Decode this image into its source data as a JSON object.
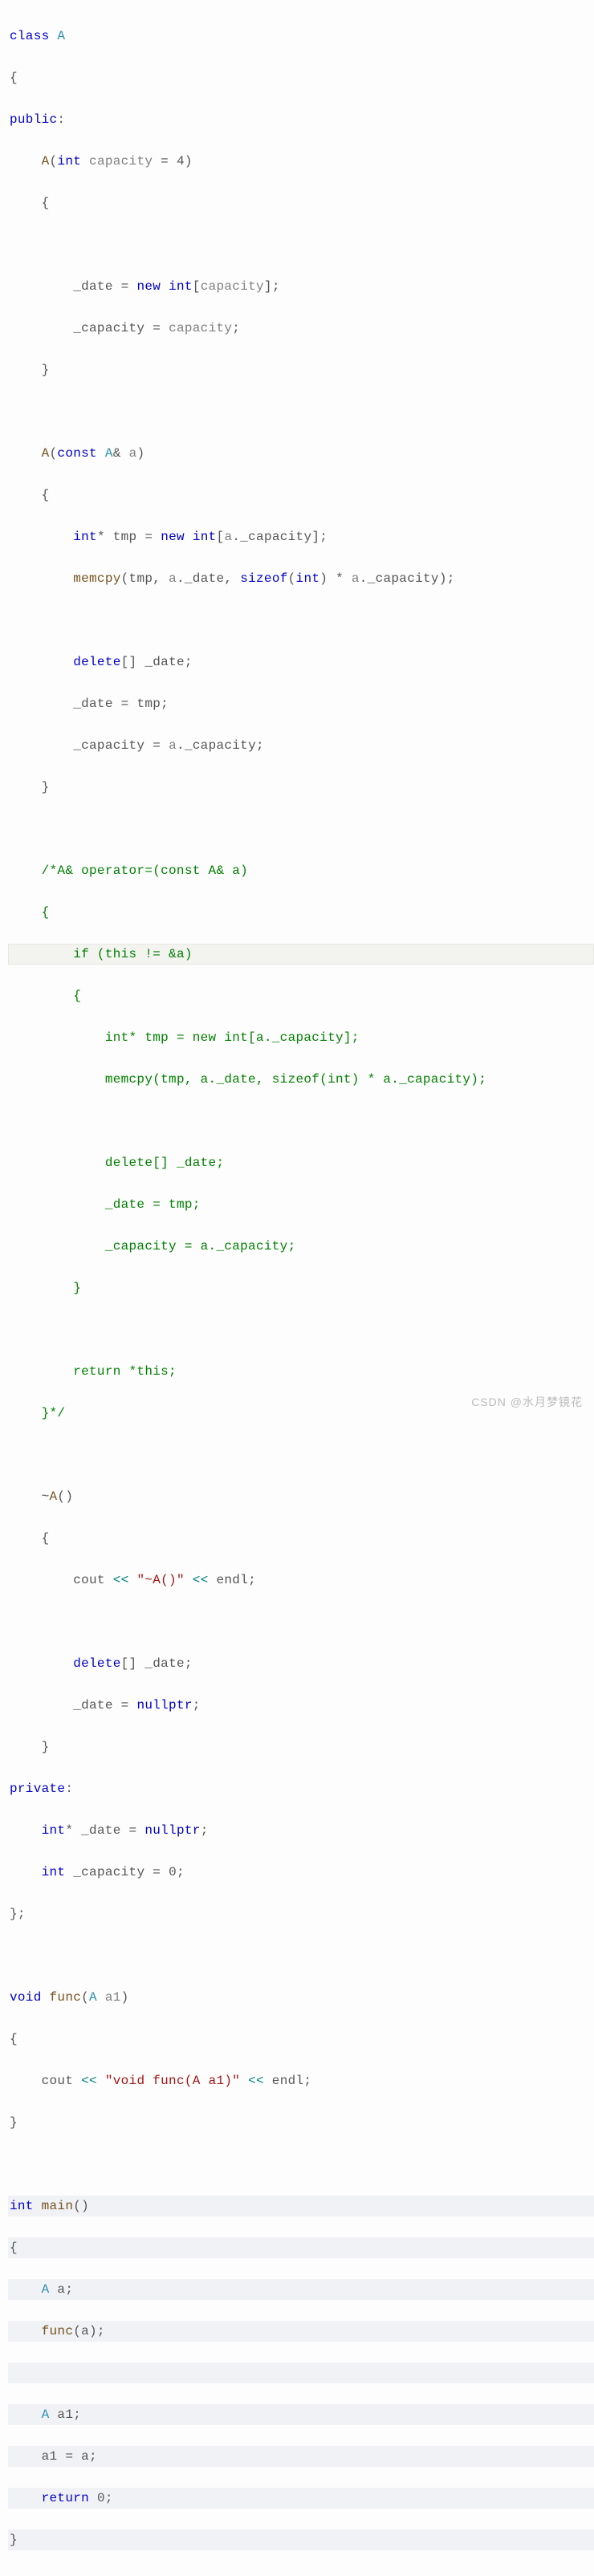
{
  "chart_data": {
    "type": "table",
    "title": "C++ source code listing",
    "language": "cpp",
    "code": "class A\n{\npublic:\n    A(int capacity = 4)\n    {\n\n        _date = new int[capacity];\n        _capacity = capacity;\n    }\n\n    A(const A& a)\n    {\n        int* tmp = new int[a._capacity];\n        memcpy(tmp, a._date, sizeof(int) * a._capacity);\n\n        delete[] _date;\n        _date = tmp;\n        _capacity = a._capacity;\n    }\n\n    /*A& operator=(const A& a)\n    {\n        if (this != &a)\n        {\n            int* tmp = new int[a._capacity];\n            memcpy(tmp, a._date, sizeof(int) * a._capacity);\n\n            delete[] _date;\n            _date = tmp;\n            _capacity = a._capacity;\n        }\n\n        return *this;\n    }*/\n\n    ~A()\n    {\n        cout << \"~A()\" << endl;\n\n        delete[] _date;\n        _date = nullptr;\n    }\nprivate:\n    int* _date = nullptr;\n    int _capacity = 0;\n};\n\nvoid func(A a1)\n{\n    cout << \"void func(A a1)\" << endl;\n}\n\nint main()\n{\n    A a;\n    func(a);\n\n    A a1;\n    a1 = a;\n    return 0;\n}"
  },
  "tokens": {
    "class": "class",
    "A": "A",
    "public": "public",
    "private": "private",
    "int": "int",
    "capacity": "capacity",
    "eq": "=",
    "four": "4",
    "new": "new",
    "const": "const",
    "amp": "&",
    "a": "a",
    "tmp": "tmp",
    "memcpy": "memcpy",
    "sizeof": "sizeof",
    "delete": "delete",
    "operator": "operator",
    "if": "if",
    "this": "this",
    "return": "return",
    "tilde": "~",
    "cout": "cout",
    "ll": "<<",
    "endl": "endl",
    "nullptr": "nullptr",
    "void": "void",
    "func": "func",
    "a1": "a1",
    "main": "main",
    "zero": "0",
    "date": "_date",
    "cap": "_capacity",
    "star": "*",
    "semi": ";",
    "str_dtor": "\"~A()\"",
    "str_func": "\"void func(A a1)\"",
    "cmt1": "/*A& operator=(const A& a)",
    "cmt2": "{",
    "cmt3": "if (this != &a)",
    "cmt4": "{",
    "cmt5": "int* tmp = new int[a._capacity];",
    "cmt6": "memcpy(tmp, a._date, sizeof(int) * a._capacity);",
    "cmt7": "delete[] _date;",
    "cmt8": "_date = tmp;",
    "cmt9": "_capacity = a._capacity;",
    "cmt10": "}",
    "cmt11": "return *this;",
    "cmt12": "}*/"
  },
  "watermark": "CSDN @水月梦镜花"
}
